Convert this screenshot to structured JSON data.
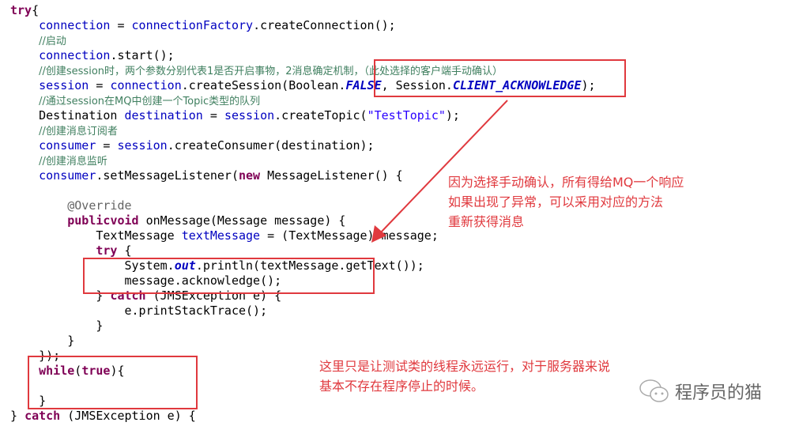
{
  "code_lines": [
    [
      [
        "kw",
        "try"
      ],
      [
        "",
        "{"
      ]
    ],
    [
      [
        "",
        "    "
      ],
      [
        "fd",
        "connection"
      ],
      [
        "",
        " = "
      ],
      [
        "fd",
        "connectionFactory"
      ],
      [
        "",
        ".createConnection();"
      ]
    ],
    [
      [
        "",
        "    "
      ],
      [
        "cm",
        "//启动"
      ]
    ],
    [
      [
        "",
        "    "
      ],
      [
        "fd",
        "connection"
      ],
      [
        "",
        ".start();"
      ]
    ],
    [
      [
        "",
        "    "
      ],
      [
        "cm",
        "//创建session时，两个参数分别代表1是否开启事物，2消息确定机制，（此处选择的客户端手动确认）"
      ]
    ],
    [
      [
        "",
        "    "
      ],
      [
        "fd",
        "session"
      ],
      [
        "",
        " = "
      ],
      [
        "fd",
        "connection"
      ],
      [
        "",
        ".createSession(Boolean."
      ],
      [
        "sf",
        "FALSE"
      ],
      [
        "",
        ", Session."
      ],
      [
        "sf",
        "CLIENT_ACKNOWLEDGE"
      ],
      [
        "",
        ");"
      ]
    ],
    [
      [
        "",
        "    "
      ],
      [
        "cm",
        "//通过session在MQ中创建一个Topic类型的队列"
      ]
    ],
    [
      [
        "",
        "    Destination "
      ],
      [
        "fd",
        "destination"
      ],
      [
        "",
        " = "
      ],
      [
        "fd",
        "session"
      ],
      [
        "",
        ".createTopic("
      ],
      [
        "st",
        "\"TestTopic\""
      ],
      [
        "",
        ");"
      ]
    ],
    [
      [
        "",
        "    "
      ],
      [
        "cm",
        "//创建消息订阅者"
      ]
    ],
    [
      [
        "",
        "    "
      ],
      [
        "fd",
        "consumer"
      ],
      [
        "",
        " = "
      ],
      [
        "fd",
        "session"
      ],
      [
        "",
        ".createConsumer(destination);"
      ]
    ],
    [
      [
        "",
        "    "
      ],
      [
        "cm",
        "//创建消息监听"
      ]
    ],
    [
      [
        "",
        "    "
      ],
      [
        "fd",
        "consumer"
      ],
      [
        "",
        ".setMessageListener("
      ],
      [
        "kw",
        "new"
      ],
      [
        "",
        " MessageListener() {"
      ]
    ],
    [],
    [
      [
        "",
        "        "
      ],
      [
        "an",
        "@Override"
      ]
    ],
    [
      [
        "",
        "        "
      ],
      [
        "kw",
        "public"
      ],
      [
        "",
        "",
        " "
      ],
      [
        "kw",
        "void"
      ],
      [
        "",
        " onMessage(Message message) {"
      ]
    ],
    [
      [
        "",
        "            TextMessage "
      ],
      [
        "fd",
        "textMessage"
      ],
      [
        "",
        " = (TextMessage) message;"
      ]
    ],
    [
      [
        "",
        "            "
      ],
      [
        "kw",
        "try"
      ],
      [
        "",
        " {"
      ]
    ],
    [
      [
        "",
        "                System."
      ],
      [
        "sf",
        "out"
      ],
      [
        "",
        ".println(textMessage.getText());"
      ]
    ],
    [
      [
        "",
        "                message.acknowledge();"
      ]
    ],
    [
      [
        "",
        "            } "
      ],
      [
        "kw",
        "catch"
      ],
      [
        "",
        " (JMSException e) {"
      ]
    ],
    [
      [
        "",
        "                e.printStackTrace();"
      ]
    ],
    [
      [
        "",
        "            }"
      ]
    ],
    [
      [
        "",
        "        }"
      ]
    ],
    [
      [
        "",
        "    });"
      ]
    ],
    [
      [
        "",
        "    "
      ],
      [
        "kw",
        "while"
      ],
      [
        "",
        "("
      ],
      [
        "kw",
        "true"
      ],
      [
        "",
        "){"
      ]
    ],
    [],
    [
      [
        "",
        "    }"
      ]
    ],
    [
      [
        "",
        "} "
      ],
      [
        "kw",
        "catch"
      ],
      [
        "",
        " (JMSException e) {"
      ]
    ]
  ],
  "annotations": {
    "note1": [
      "因为选择手动确认，所有得给MQ一个响应",
      "如果出现了异常，可以采用对应的方法",
      "重新获得消息"
    ],
    "note2": [
      "这里只是让测试类的线程永远运行，对于服务器来说",
      "基本不存在程序停止的时候。"
    ]
  },
  "watermark": {
    "icon": "wechat-icon",
    "text": "程序员的猫"
  },
  "colors": {
    "annotation": "#e0393e",
    "keyword": "#7f0055",
    "comment": "#3f7f5f",
    "field": "#0000c0",
    "string": "#2a00ff"
  }
}
